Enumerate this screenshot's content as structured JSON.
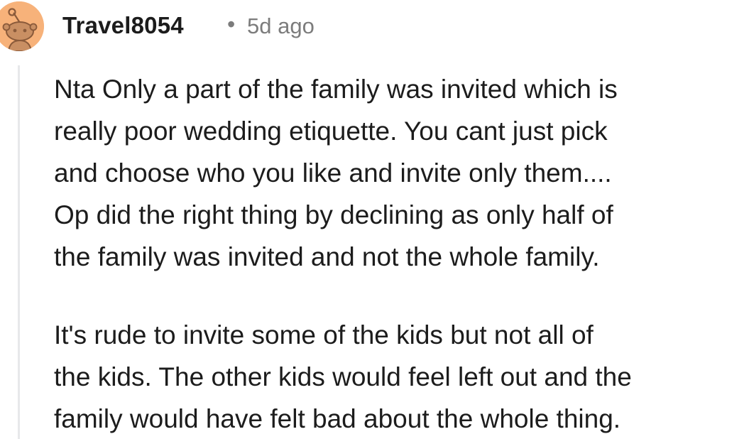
{
  "comment": {
    "author": "Travel8054",
    "separator": "•",
    "time_ago": "5d ago",
    "avatar_icon": "snoo-avatar-icon",
    "avatar_color": "#f7b27a",
    "paragraphs": [
      "Nta Only a part of the family was invited which is\nreally poor wedding etiquette. You cant just pick\nand choose who you like and invite only them....\nOp did the right thing by declining as only half of\nthe family was invited and not the whole family.",
      "It's rude to invite some of the kids but not all of\nthe kids. The other kids would feel left out and the\nfamily would have felt bad about the whole thing."
    ]
  }
}
